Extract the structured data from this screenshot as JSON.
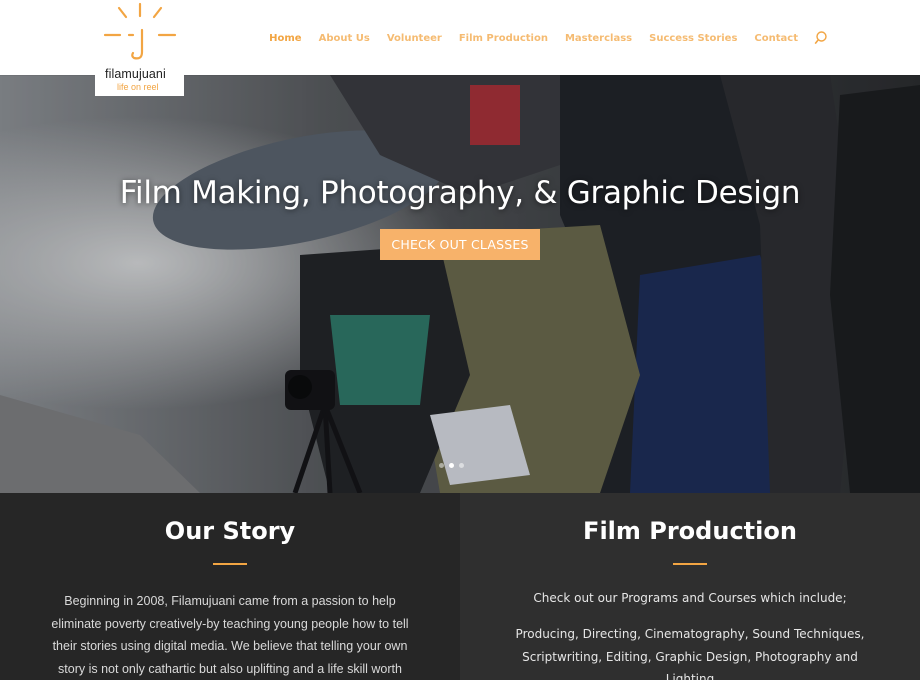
{
  "brand": {
    "name": "filamujuani",
    "tagline": "life on reel",
    "accent": "#f2a543"
  },
  "nav": {
    "items": [
      {
        "label": "Home",
        "active": true
      },
      {
        "label": "About Us"
      },
      {
        "label": "Volunteer"
      },
      {
        "label": "Film Production"
      },
      {
        "label": "Masterclass"
      },
      {
        "label": "Success Stories"
      },
      {
        "label": "Contact"
      }
    ],
    "search_icon": "search-icon"
  },
  "hero": {
    "title": "Film Making, Photography, & Graphic Design",
    "button_label": "CHECK OUT CLASSES",
    "button_color": "#f7b26a",
    "slides": 3,
    "active_slide": 2
  },
  "our_story": {
    "heading": "Our Story",
    "text": "Beginning in 2008, Filamujuani came from a passion to help eliminate poverty creatively-by teaching young people how to tell their stories using digital media. We believe that telling your own story is not only cathartic but also uplifting and a life skill worth"
  },
  "film_production": {
    "heading": "Film Production",
    "intro": "Check out our Programs and Courses which include;",
    "list": "Producing, Directing, Cinematography, Sound Techniques, Scriptwriting, Editing, Graphic Design, Photography and Lighting"
  }
}
